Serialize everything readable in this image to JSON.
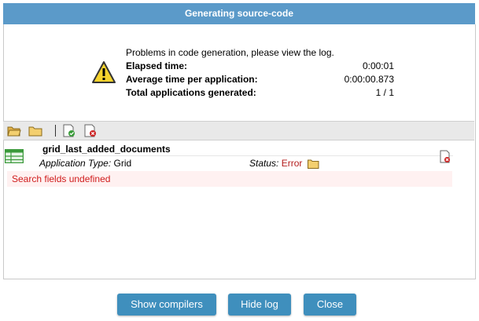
{
  "dialog": {
    "title": "Generating source-code"
  },
  "summary": {
    "message": "Problems in code generation, please view the log.",
    "rows": [
      {
        "label": "Elapsed time:",
        "value": "0:00:01"
      },
      {
        "label": "Average time per application:",
        "value": "0:00:00.873"
      },
      {
        "label": "Total applications generated:",
        "value": "1 / 1"
      }
    ]
  },
  "icons": {
    "warning": "warning-icon",
    "toolbar": [
      "open-folder-icon",
      "folder-icon",
      "doc-ok-icon",
      "doc-error-icon"
    ],
    "app": "grid-icon",
    "delete": "doc-error-icon"
  },
  "app": {
    "name": "grid_last_added_documents",
    "type_label": "Application Type:",
    "type_value": "Grid",
    "status_label": "Status:",
    "status_value": "Error",
    "error_message": "Search fields undefined"
  },
  "buttons": {
    "show_compilers": "Show compilers",
    "hide_log": "Hide log",
    "close": "Close"
  },
  "colors": {
    "titlebar": "#5b9ac9",
    "button": "#3f8fbd",
    "error_text": "#d01c1c",
    "error_bg": "#fff1f1",
    "status_error": "#b41e1e"
  }
}
